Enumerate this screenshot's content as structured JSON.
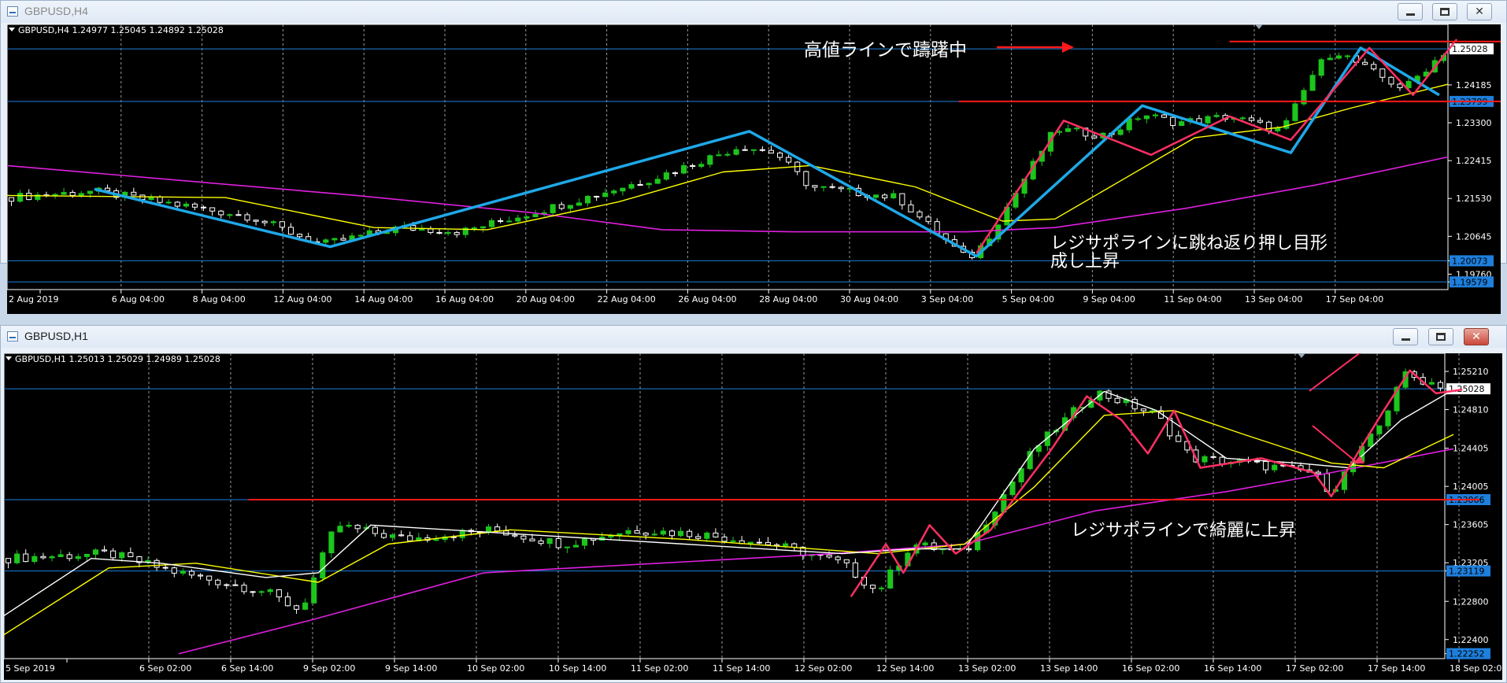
{
  "colors": {
    "bg": "#000000",
    "grid": "#c0c0c0",
    "axis": "#ffffff",
    "hline": "#1e7fdc",
    "bull": "#1dc51d",
    "bear": "#ffffff",
    "ma_magenta": "#e020e0",
    "ma_yellow": "#ffff00",
    "ma_white": "#ffffff",
    "zig_cyan": "#1ea8e8",
    "zig_pink": "#ff2f62",
    "red_line": "#ff1a1a",
    "tag_current": "#ffffff",
    "tag_level": "#1e7fdc"
  },
  "top_window": {
    "title": "GBPUSD,H4",
    "controls": [
      "minimize-icon",
      "maximize-icon",
      "close-icon"
    ],
    "close_glyph": "✕",
    "info": "GBPUSD,H4  1.24977 1.25045 1.24892 1.25028",
    "annotations": [
      "高値ラインで躊躇中",
      "レジサポラインに跳ね返り押し目形",
      "成し上昇"
    ]
  },
  "bottom_window": {
    "title": "GBPUSD,H1",
    "controls": [
      "minimize-icon",
      "maximize-icon",
      "close-icon"
    ],
    "close_glyph": "✕",
    "info": "GBPUSD,H1  1.25013 1.25029 1.24989 1.25028",
    "annotations": [
      "レジサポラインで綺麗に上昇"
    ]
  },
  "chart_data": [
    {
      "type": "candlestick",
      "symbol": "GBPUSD",
      "timeframe": "H4",
      "ylim": [
        1.194,
        1.256
      ],
      "yticks": [
        1.25028,
        1.24185,
        1.23799,
        1.233,
        1.22415,
        1.2153,
        1.20645,
        1.20073,
        1.1976,
        1.19579
      ],
      "price_tags": [
        {
          "value": 1.25028,
          "kind": "current"
        },
        {
          "value": 1.23799,
          "kind": "level"
        },
        {
          "value": 1.20073,
          "kind": "level"
        },
        {
          "value": 1.19579,
          "kind": "level"
        }
      ],
      "x_labels": [
        "2 Aug 2019",
        "6 Aug 04:00",
        "8 Aug 04:00",
        "12 Aug 04:00",
        "14 Aug 04:00",
        "16 Aug 04:00",
        "20 Aug 04:00",
        "22 Aug 04:00",
        "26 Aug 04:00",
        "28 Aug 04:00",
        "30 Aug 04:00",
        "3 Sep 04:00",
        "5 Sep 04:00",
        "9 Sep 04:00",
        "11 Sep 04:00",
        "13 Sep 04:00",
        "17 Sep 04:00"
      ],
      "n_bars": 165,
      "horizontal_lines": [
        1.25028,
        1.23799,
        1.20073,
        1.19579
      ],
      "price_path": [
        [
          0,
          1.2155
        ],
        [
          10,
          1.217
        ],
        [
          28,
          1.211
        ],
        [
          36,
          1.2045
        ],
        [
          45,
          1.2085
        ],
        [
          52,
          1.2075
        ],
        [
          62,
          1.213
        ],
        [
          74,
          1.22
        ],
        [
          84,
          1.2275
        ],
        [
          88,
          1.226
        ],
        [
          92,
          1.218
        ],
        [
          102,
          1.2155
        ],
        [
          110,
          1.201
        ],
        [
          112,
          1.205
        ],
        [
          120,
          1.2315
        ],
        [
          126,
          1.23
        ],
        [
          130,
          1.235
        ],
        [
          134,
          1.233
        ],
        [
          140,
          1.2345
        ],
        [
          146,
          1.231
        ],
        [
          150,
          1.246
        ],
        [
          152,
          1.25
        ],
        [
          158,
          1.243
        ],
        [
          160,
          1.241
        ],
        [
          165,
          1.2503
        ]
      ],
      "series": [
        {
          "kind": "ma_slow",
          "points": [
            [
              0,
              1.223
            ],
            [
              20,
              1.2195
            ],
            [
              40,
              1.216
            ],
            [
              60,
              1.212
            ],
            [
              75,
              1.208
            ],
            [
              90,
              1.2075
            ],
            [
              110,
              1.2075
            ],
            [
              120,
              1.2085
            ],
            [
              135,
              1.213
            ],
            [
              150,
              1.2185
            ],
            [
              165,
              1.225
            ]
          ]
        },
        {
          "kind": "ma_fast",
          "points": [
            [
              0,
              1.216
            ],
            [
              25,
              1.2155
            ],
            [
              42,
              1.2085
            ],
            [
              55,
              1.208
            ],
            [
              70,
              1.2145
            ],
            [
              82,
              1.2215
            ],
            [
              92,
              1.223
            ],
            [
              104,
              1.218
            ],
            [
              114,
              1.21
            ],
            [
              120,
              1.2105
            ],
            [
              128,
              1.22
            ],
            [
              136,
              1.2295
            ],
            [
              146,
              1.232
            ],
            [
              154,
              1.2365
            ],
            [
              165,
              1.242
            ]
          ]
        },
        {
          "kind": "zigzag_cyan",
          "points": [
            [
              10,
              1.2175
            ],
            [
              37,
              1.204
            ],
            [
              85,
              1.231
            ],
            [
              111,
              1.2018
            ],
            [
              130,
              1.237
            ],
            [
              147,
              1.226
            ],
            [
              155,
              1.2505
            ],
            [
              164,
              1.2395
            ]
          ]
        },
        {
          "kind": "zigzag_pink",
          "points": [
            [
              111,
              1.2025
            ],
            [
              121,
              1.2335
            ],
            [
              131,
              1.2255
            ],
            [
              140,
              1.2345
            ],
            [
              147,
              1.229
            ],
            [
              156,
              1.2505
            ],
            [
              161,
              1.2395
            ],
            [
              166,
              1.2525
            ]
          ]
        },
        {
          "kind": "red_line",
          "points": [
            [
              109,
              1.23799
            ],
            [
              181,
              1.23799
            ]
          ]
        },
        {
          "kind": "red_line",
          "points": [
            [
              140,
              1.252
            ],
            [
              172,
              1.252
            ]
          ]
        }
      ]
    },
    {
      "type": "candlestick",
      "symbol": "GBPUSD",
      "timeframe": "H1",
      "ylim": [
        1.222,
        1.254
      ],
      "yticks": [
        1.2521,
        1.25028,
        1.2481,
        1.24405,
        1.24005,
        1.23866,
        1.23605,
        1.23205,
        1.23119,
        1.228,
        1.224,
        1.22252
      ],
      "price_tags": [
        {
          "value": 1.25028,
          "kind": "current"
        },
        {
          "value": 1.23866,
          "kind": "level"
        },
        {
          "value": 1.23119,
          "kind": "level"
        },
        {
          "value": 1.22252,
          "kind": "level"
        }
      ],
      "x_labels": [
        "5 Sep 2019",
        "6 Sep 02:00",
        "6 Sep 14:00",
        "9 Sep 02:00",
        "9 Sep 14:00",
        "10 Sep 02:00",
        "10 Sep 14:00",
        "11 Sep 02:00",
        "11 Sep 14:00",
        "12 Sep 02:00",
        "12 Sep 14:00",
        "13 Sep 02:00",
        "13 Sep 14:00",
        "16 Sep 02:00",
        "16 Sep 14:00",
        "17 Sep 02:00",
        "17 Sep 14:00",
        "18 Sep 02:00"
      ],
      "n_bars": 165,
      "horizontal_lines": [
        1.25028,
        1.23866,
        1.23119
      ],
      "price_path": [
        [
          0,
          1.2325
        ],
        [
          12,
          1.233
        ],
        [
          20,
          1.231
        ],
        [
          30,
          1.229
        ],
        [
          34,
          1.227
        ],
        [
          38,
          1.236
        ],
        [
          46,
          1.2345
        ],
        [
          56,
          1.2355
        ],
        [
          64,
          1.234
        ],
        [
          72,
          1.2355
        ],
        [
          80,
          1.235
        ],
        [
          88,
          1.234
        ],
        [
          96,
          1.232
        ],
        [
          100,
          1.229
        ],
        [
          104,
          1.234
        ],
        [
          110,
          1.233
        ],
        [
          118,
          1.244
        ],
        [
          125,
          1.25
        ],
        [
          132,
          1.2475
        ],
        [
          136,
          1.243
        ],
        [
          142,
          1.2425
        ],
        [
          150,
          1.2415
        ],
        [
          152,
          1.2395
        ],
        [
          158,
          1.247
        ],
        [
          160,
          1.2518
        ],
        [
          166,
          1.2503
        ]
      ],
      "series": [
        {
          "kind": "ma_slow",
          "points": [
            [
              20,
              1.2225
            ],
            [
              35,
              1.226
            ],
            [
              55,
              1.231
            ],
            [
              75,
              1.232
            ],
            [
              95,
              1.233
            ],
            [
              110,
              1.234
            ],
            [
              125,
              1.2375
            ],
            [
              140,
              1.2395
            ],
            [
              152,
              1.2415
            ],
            [
              166,
              1.244
            ]
          ]
        },
        {
          "kind": "ma_fast",
          "points": [
            [
              0,
              1.2245
            ],
            [
              12,
              1.2315
            ],
            [
              22,
              1.232
            ],
            [
              36,
              1.23
            ],
            [
              44,
              1.234
            ],
            [
              58,
              1.2355
            ],
            [
              78,
              1.2345
            ],
            [
              100,
              1.233
            ],
            [
              110,
              1.234
            ],
            [
              118,
              1.24
            ],
            [
              126,
              1.2475
            ],
            [
              134,
              1.248
            ],
            [
              142,
              1.2455
            ],
            [
              152,
              1.2425
            ],
            [
              158,
              1.242
            ],
            [
              166,
              1.2455
            ]
          ]
        },
        {
          "kind": "ma_white",
          "points": [
            [
              0,
              1.2265
            ],
            [
              10,
              1.2325
            ],
            [
              18,
              1.232
            ],
            [
              30,
              1.2305
            ],
            [
              36,
              1.231
            ],
            [
              42,
              1.236
            ],
            [
              60,
              1.235
            ],
            [
              78,
              1.234
            ],
            [
              96,
              1.233
            ],
            [
              104,
              1.2335
            ],
            [
              110,
              1.2335
            ],
            [
              118,
              1.244
            ],
            [
              126,
              1.25
            ],
            [
              132,
              1.248
            ],
            [
              140,
              1.243
            ],
            [
              148,
              1.2425
            ],
            [
              154,
              1.242
            ],
            [
              160,
              1.247
            ],
            [
              166,
              1.2502
            ]
          ]
        },
        {
          "kind": "zigzag_pink",
          "points": [
            [
              97,
              1.2285
            ],
            [
              101,
              1.234
            ],
            [
              103,
              1.231
            ],
            [
              106,
              1.236
            ],
            [
              109,
              1.233
            ],
            [
              113,
              1.2355
            ],
            [
              120,
              1.244
            ],
            [
              124,
              1.2495
            ],
            [
              128,
              1.247
            ],
            [
              131,
              1.2435
            ],
            [
              134,
              1.248
            ],
            [
              137,
              1.242
            ],
            [
              144,
              1.243
            ],
            [
              150,
              1.2415
            ],
            [
              152,
              1.239
            ],
            [
              158,
              1.248
            ],
            [
              161,
              1.2522
            ],
            [
              164,
              1.2498
            ],
            [
              167,
              1.2502
            ]
          ]
        },
        {
          "kind": "red_line",
          "points": [
            [
              28,
              1.23866
            ],
            [
              169,
              1.23866
            ]
          ]
        }
      ]
    }
  ]
}
